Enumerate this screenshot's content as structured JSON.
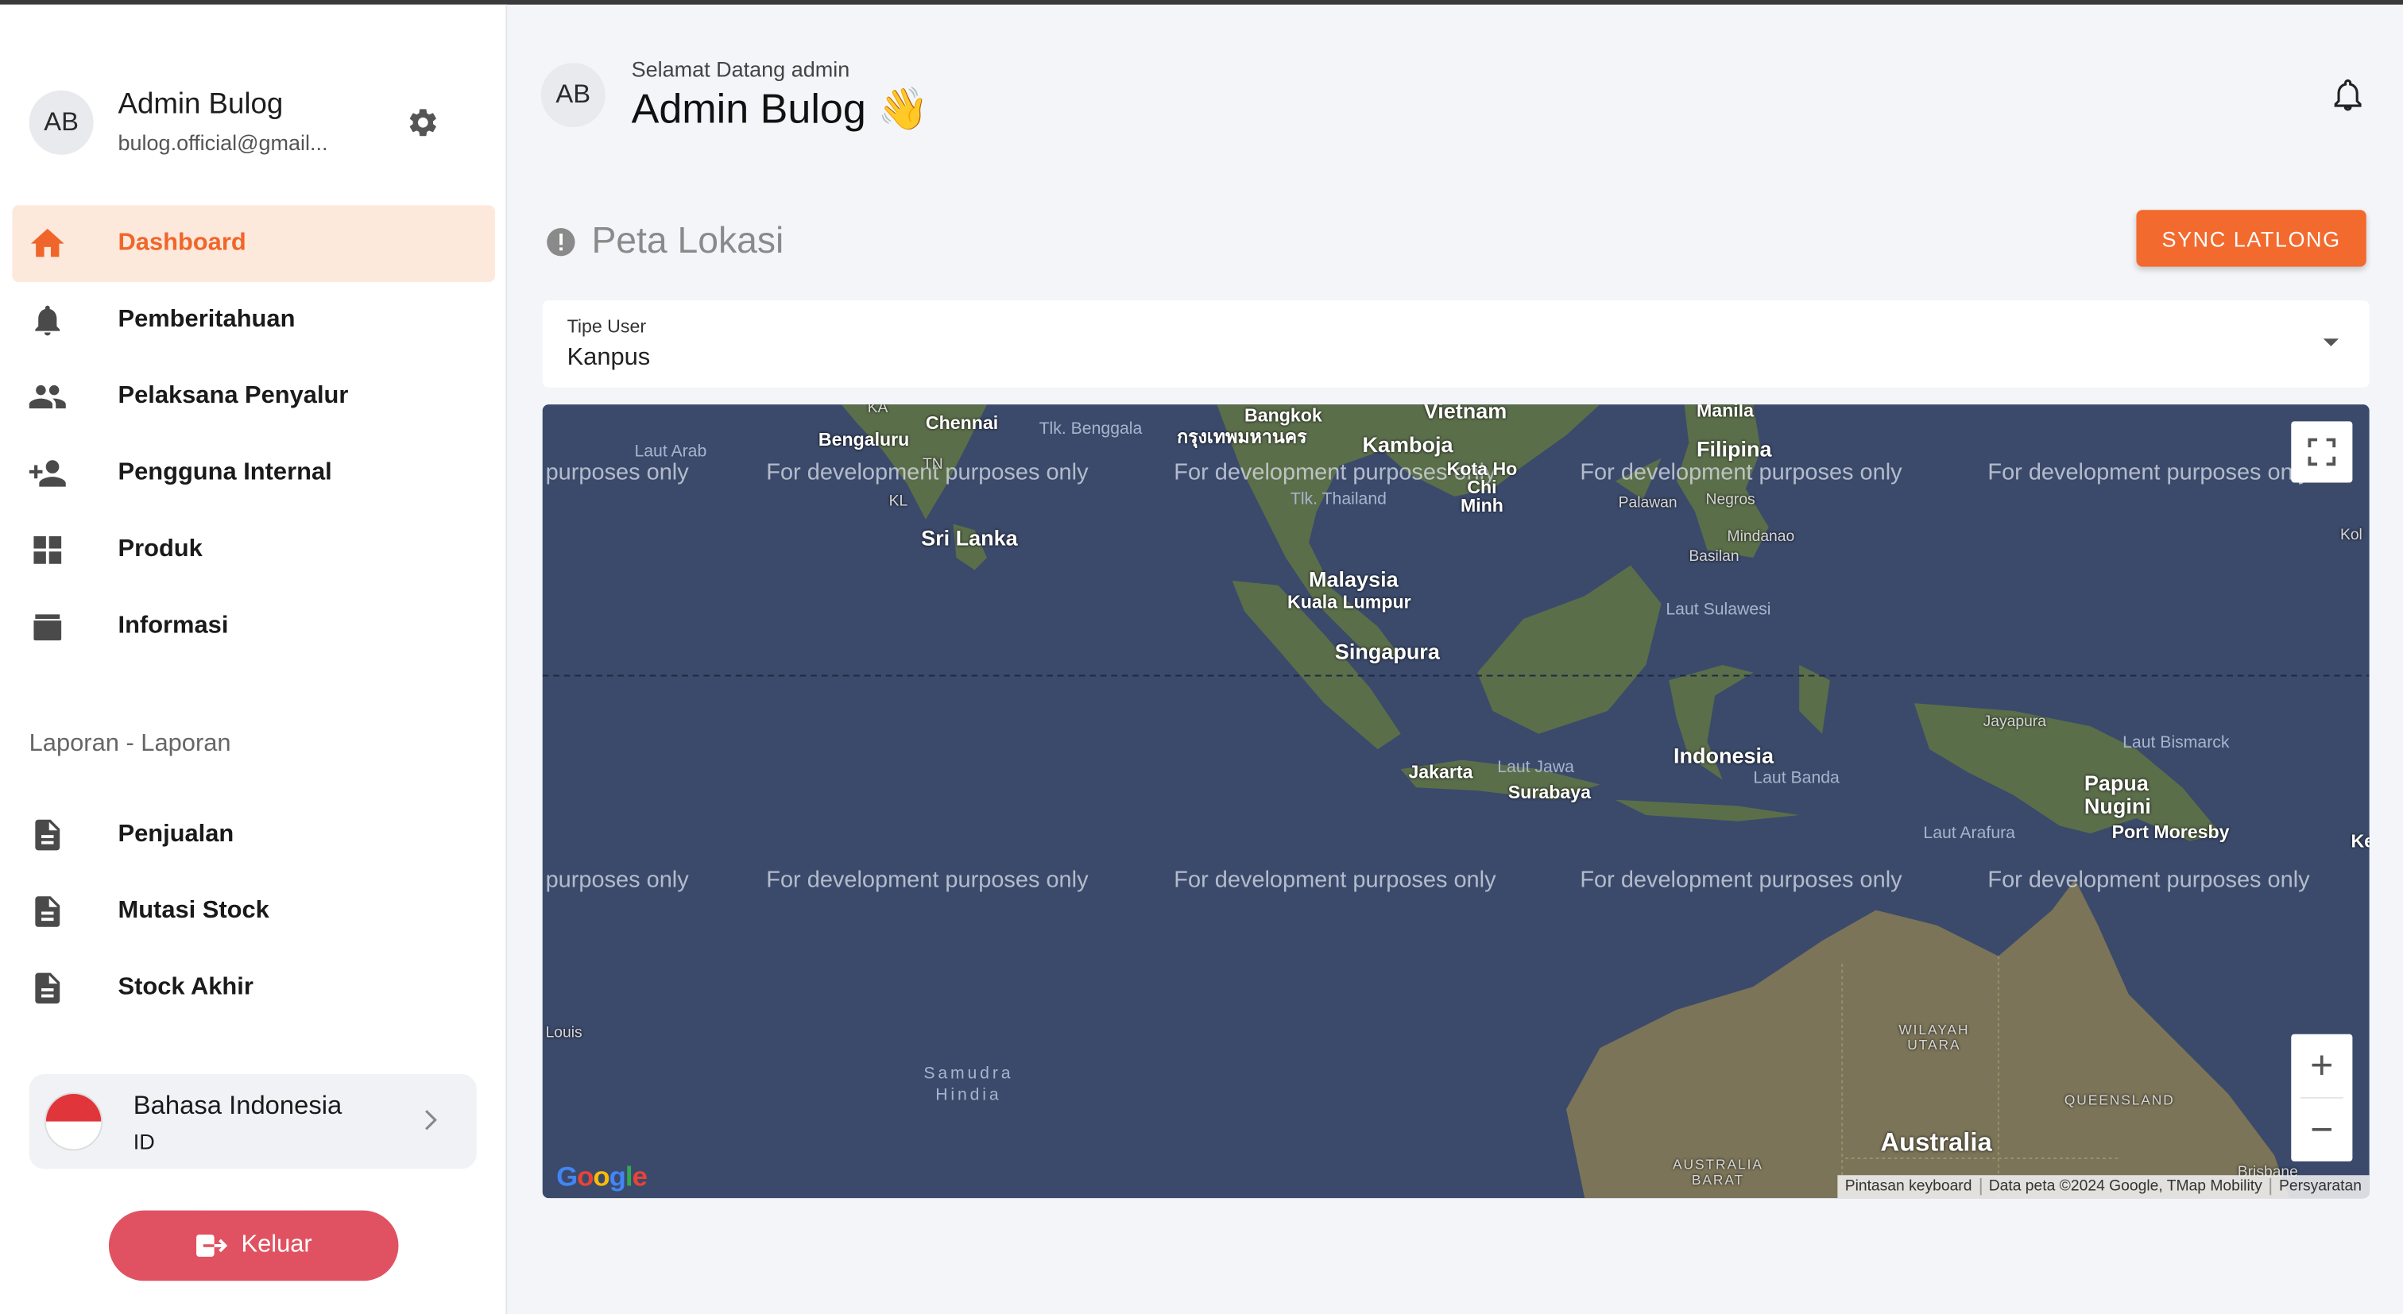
{
  "sidebar": {
    "profile": {
      "initials": "AB",
      "name": "Admin Bulog",
      "email": "bulog.official@gmail..."
    },
    "nav": [
      {
        "label": "Dashboard",
        "icon": "home-icon",
        "active": true
      },
      {
        "label": "Pemberitahuan",
        "icon": "bell-icon"
      },
      {
        "label": "Pelaksana Penyalur",
        "icon": "people-icon"
      },
      {
        "label": "Pengguna Internal",
        "icon": "add-person-icon"
      },
      {
        "label": "Produk",
        "icon": "grid-icon"
      },
      {
        "label": "Informasi",
        "icon": "archive-icon"
      }
    ],
    "section_title": "Laporan - Laporan",
    "reports": [
      {
        "label": "Penjualan",
        "icon": "document-icon"
      },
      {
        "label": "Mutasi Stock",
        "icon": "document-icon"
      },
      {
        "label": "Stock Akhir",
        "icon": "document-icon"
      }
    ],
    "language": {
      "name": "Bahasa Indonesia",
      "code": "ID"
    },
    "logout_label": "Keluar"
  },
  "header": {
    "initials": "AB",
    "welcome": "Selamat Datang admin",
    "title": "Admin Bulog 👋"
  },
  "main": {
    "section_title": "Peta Lokasi",
    "sync_button": "SYNC LATLONG",
    "select": {
      "label": "Tipe User",
      "value": "Kanpus"
    }
  },
  "map": {
    "dev_text": "For development purposes only",
    "dev_text_partial": "purposes only",
    "labels": {
      "chennai": "Chennai",
      "bengaluru": "Bengaluru",
      "sri_lanka": "Sri Lanka",
      "laut_arab": "Laut Arab",
      "tlk_benggala": "Tlk. Benggala",
      "bangkok": "Bangkok",
      "bangkok_th": "กรุงเทพมหานคร",
      "vietnam": "Vietnam",
      "kamboja": "Kamboja",
      "ho_chi_minh": "Kota Ho Chi Minh",
      "tlk_thailand": "Tlk. Thailand",
      "manila": "Manila",
      "filipina": "Filipina",
      "palawan": "Palawan",
      "negros": "Negros",
      "mindanao": "Mindanao",
      "basilan": "Basilan",
      "malaysia": "Malaysia",
      "kuala_lumpur": "Kuala Lumpur",
      "singapura": "Singapura",
      "laut_sulawesi": "Laut Sulawesi",
      "indonesia": "Indonesia",
      "jakarta": "Jakarta",
      "laut_jawa": "Laut Jawa",
      "surabaya": "Surabaya",
      "laut_banda": "Laut Banda",
      "jayapura": "Jayapura",
      "laut_bismarck": "Laut Bismarck",
      "papua_nugini": "Papua Nugini",
      "port_moresby": "Port Moresby",
      "laut_arafura": "Laut Arafura",
      "samudra_hindia": "Samudra Hindia",
      "louis": "Louis",
      "wilayah_utara": "WILAYAH UTARA",
      "queensland": "QUEENSLAND",
      "australia": "Australia",
      "australia_barat": "AUSTRALIA BARAT",
      "ka": "KA",
      "kl": "KL",
      "tn": "TN",
      "kol": "Kol",
      "ke": "Ke",
      "brisbane": "Brisbane"
    },
    "attribution": [
      "Pintasan keyboard",
      "Data peta ©2024 Google, TMap Mobility",
      "Persyaratan"
    ],
    "google": "Google",
    "zoom_in": "+",
    "zoom_out": "−"
  },
  "colors": {
    "accent": "#f26a2e",
    "active_bg": "#fde8dc",
    "logout": "#e05262",
    "ocean": "#3b4a6b",
    "land": "#5b6e4a",
    "australia": "#7b7458"
  }
}
